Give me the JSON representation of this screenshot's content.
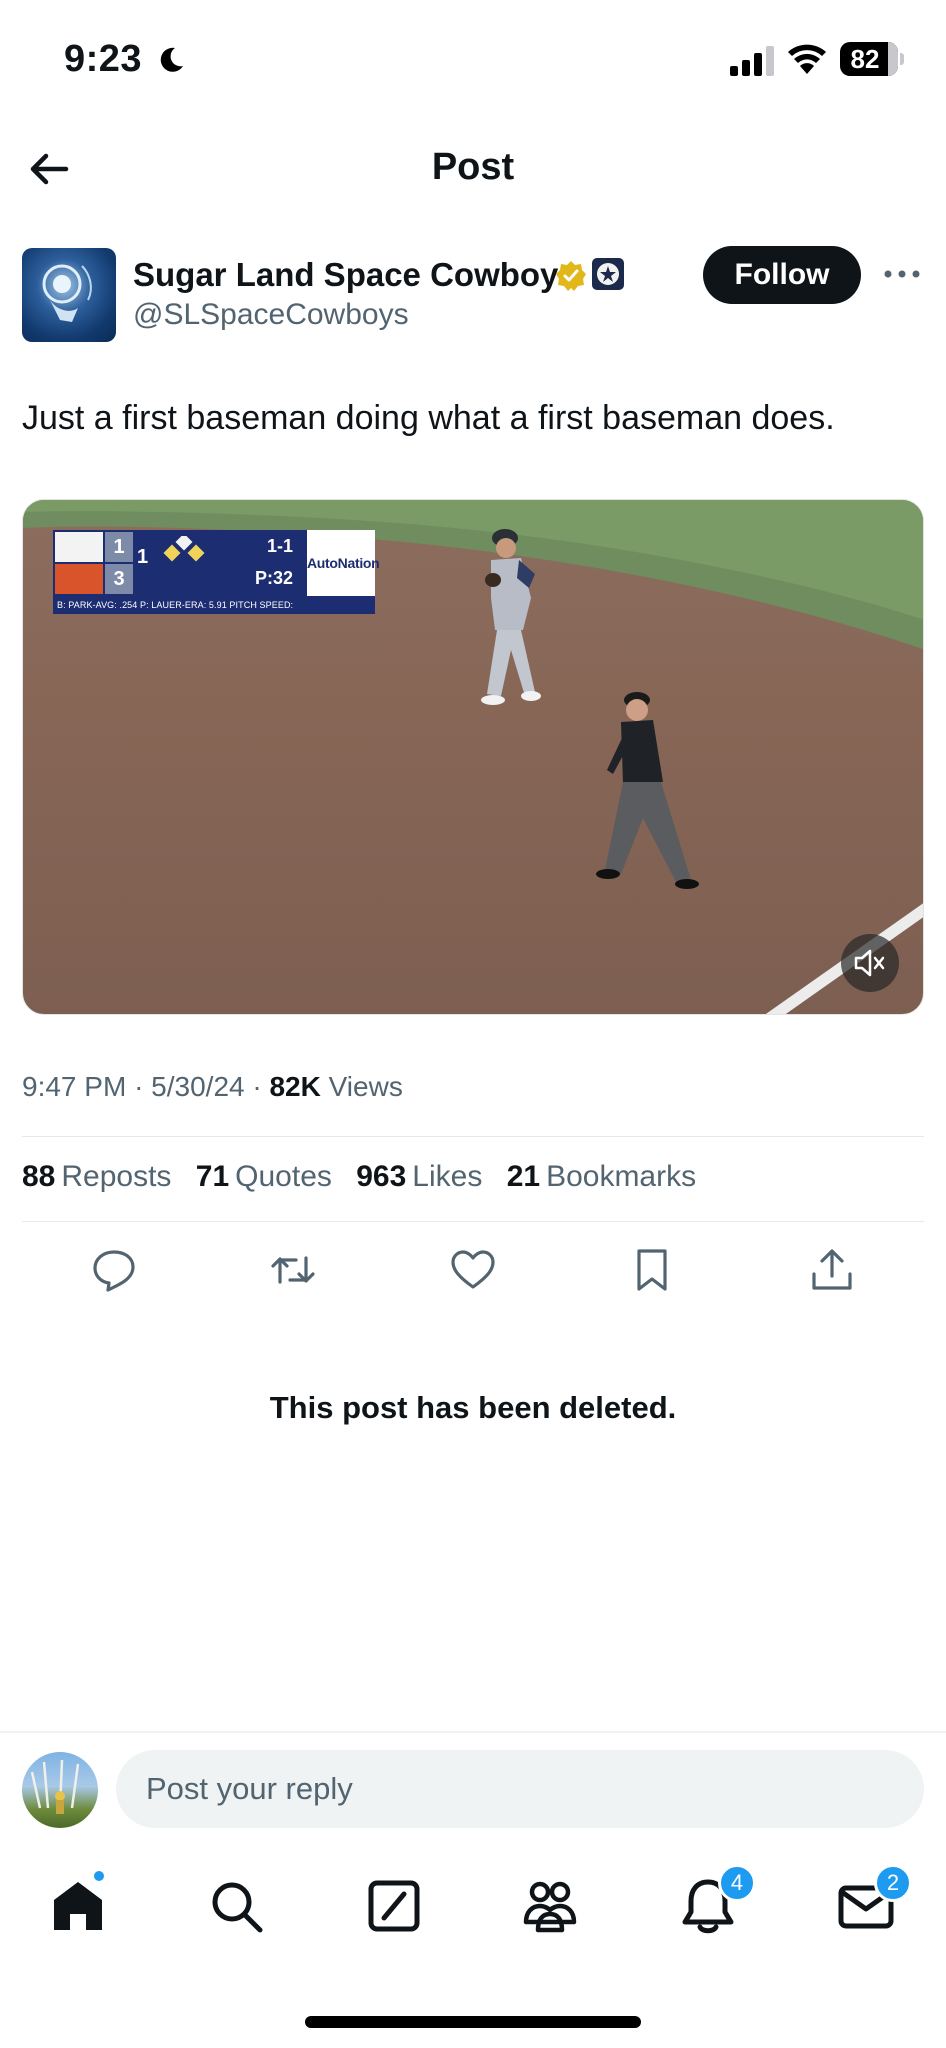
{
  "status_bar": {
    "time": "9:23",
    "battery": "82",
    "battery_level": 0.82
  },
  "header": {
    "title": "Post"
  },
  "author": {
    "name": "Sugar Land Space Cowboys",
    "handle": "@SLSpaceCowboys",
    "follow_label": "Follow"
  },
  "post": {
    "text": "Just a first baseman doing what a first baseman does.",
    "scorebug": {
      "away_score": "1",
      "home_score": "3",
      "inning": "1",
      "count": "1-1",
      "pitches": "P:32",
      "sponsor": "AutoNation",
      "stats_line": "B: PARK-AVG: .254   P: LAUER-ERA: 5.91   PITCH SPEED:"
    },
    "time": "9:47 PM",
    "date": "5/30/24",
    "views_count": "82K",
    "views_label": "Views"
  },
  "engagement": {
    "reposts_count": "88",
    "reposts_label": "Reposts",
    "quotes_count": "71",
    "quotes_label": "Quotes",
    "likes_count": "963",
    "likes_label": "Likes",
    "bookmarks_count": "21",
    "bookmarks_label": "Bookmarks"
  },
  "deleted_notice": "This post has been deleted.",
  "reply": {
    "placeholder": "Post your reply"
  },
  "tabbar": {
    "notifications_badge": "4",
    "messages_badge": "2"
  },
  "colors": {
    "accent": "#1d9bf0",
    "text": "#0f1419",
    "secondary": "#536471",
    "verified_gold": "#e2b719"
  }
}
